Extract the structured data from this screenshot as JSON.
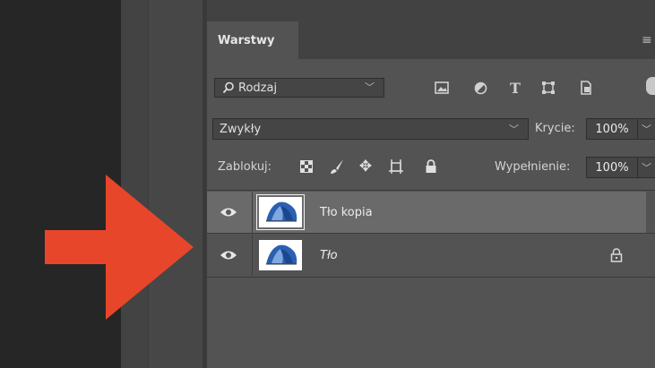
{
  "panel": {
    "tab_label": "Warstwy",
    "menu_icon": "panel-menu-icon"
  },
  "filter": {
    "kind_label": "Rodzaj",
    "icons": [
      "image-filter-icon",
      "adjustment-filter-icon",
      "type-filter-icon",
      "shape-filter-icon",
      "smart-object-filter-icon"
    ]
  },
  "blend": {
    "mode": "Zwykły",
    "opacity_label": "Krycie:",
    "opacity_value": "100%"
  },
  "lock": {
    "label": "Zablokuj:",
    "icons": [
      "lock-transparent-icon",
      "lock-image-icon",
      "lock-position-icon",
      "lock-artboard-icon",
      "lock-all-icon"
    ],
    "fill_label": "Wypełnienie:",
    "fill_value": "100%"
  },
  "layers": [
    {
      "name": "Tło kopia",
      "selected": true,
      "locked": false
    },
    {
      "name": "Tło",
      "selected": false,
      "locked": true
    }
  ],
  "colors": {
    "arrow": "#e8462a",
    "panel_bg": "#535353",
    "selected_row": "#6a6a6a",
    "tent": "#2b5fb0"
  }
}
